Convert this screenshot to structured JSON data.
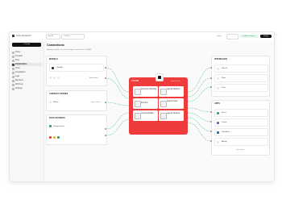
{
  "workspace": {
    "name": "Acme Research"
  },
  "topbar": {
    "ask_label": "Ask AI",
    "breadcrumb": "Untitled",
    "share_label": "Share",
    "publish_label": "Publish changes",
    "deploy_label": "Deploy"
  },
  "sidebar": {
    "new_label": "+ Create",
    "items": [
      {
        "label": "Home"
      },
      {
        "label": "Threads"
      },
      {
        "label": "Files"
      },
      {
        "label": "Connections"
      },
      {
        "label": "Tools"
      },
      {
        "label": "Integrations"
      },
      {
        "label": "Logs"
      },
      {
        "label": "Members"
      },
      {
        "label": "API Keys"
      },
      {
        "label": "Settings"
      }
    ]
  },
  "page": {
    "title": "Connections",
    "subtitle": "Manage models, sources and apps connected to CLEAR"
  },
  "models": {
    "section_label": "MODELS",
    "row_label": "OpenAI",
    "footer_label": "Add model"
  },
  "context_stores": {
    "section_label": "CONTEXT STORES",
    "row_label": "Notion",
    "row_hint": "Sync status"
  },
  "data_sources": {
    "section_label": "DATA SOURCES",
    "row_label": "Google Sheets"
  },
  "hub": {
    "title": "CLEAR",
    "badge": "Operational",
    "cards": [
      {
        "label": "Document Parsing"
      },
      {
        "label": "Agents Network"
      },
      {
        "label": "Prompts"
      },
      {
        "label": "Search Index"
      },
      {
        "label": "Context Builder"
      },
      {
        "label": "Agents Network"
      }
    ]
  },
  "interfaces": {
    "section_label": "INTERFACES",
    "items": [
      {
        "label": "Web UI"
      },
      {
        "label": "Slack"
      },
      {
        "label": "Chat"
      }
    ]
  },
  "apps": {
    "section_label": "APPS",
    "items": [
      {
        "label": "Excel"
      },
      {
        "label": "Teams"
      },
      {
        "label": "PitchBook"
      },
      {
        "label": "Affinity"
      }
    ],
    "footer_label": "View more"
  },
  "colors": {
    "accent": "#ef3b3b",
    "deploy": "#111111",
    "publish": "#1f9d55"
  }
}
